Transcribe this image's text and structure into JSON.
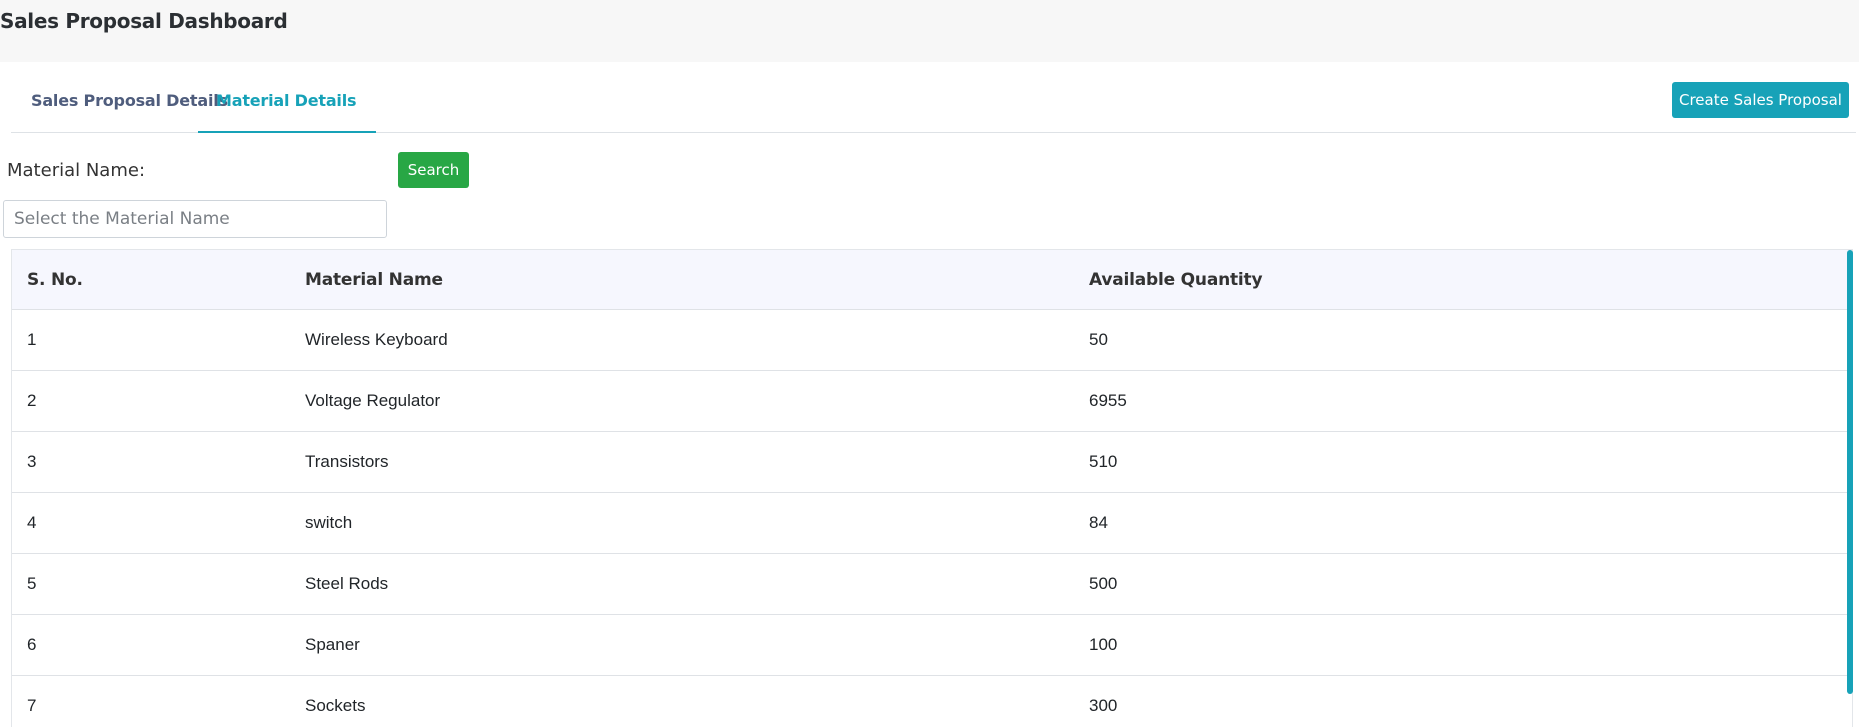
{
  "header": {
    "title": "Sales Proposal Dashboard"
  },
  "tabs": [
    {
      "label": "Sales Proposal Details",
      "active": false
    },
    {
      "label": "Material Details",
      "active": true
    }
  ],
  "actions": {
    "create_label": "Create Sales Proposal"
  },
  "search": {
    "label": "Material Name:",
    "button_label": "Search",
    "placeholder": "Select the Material Name",
    "value": ""
  },
  "table": {
    "columns": [
      "S. No.",
      "Material Name",
      "Available Quantity"
    ],
    "rows": [
      [
        "1",
        "Wireless Keyboard",
        "50"
      ],
      [
        "2",
        "Voltage Regulator",
        "6955"
      ],
      [
        "3",
        "Transistors",
        "510"
      ],
      [
        "4",
        "switch",
        "84"
      ],
      [
        "5",
        "Steel Rods",
        "500"
      ],
      [
        "6",
        "Spaner",
        "100"
      ],
      [
        "7",
        "Sockets",
        "300"
      ]
    ]
  },
  "colors": {
    "accent": "#17a2b8",
    "success": "#28a745",
    "tab_inactive": "#4f5d7d",
    "header_bg": "#f7f7f7",
    "table_head_bg": "#f6f7fe"
  }
}
